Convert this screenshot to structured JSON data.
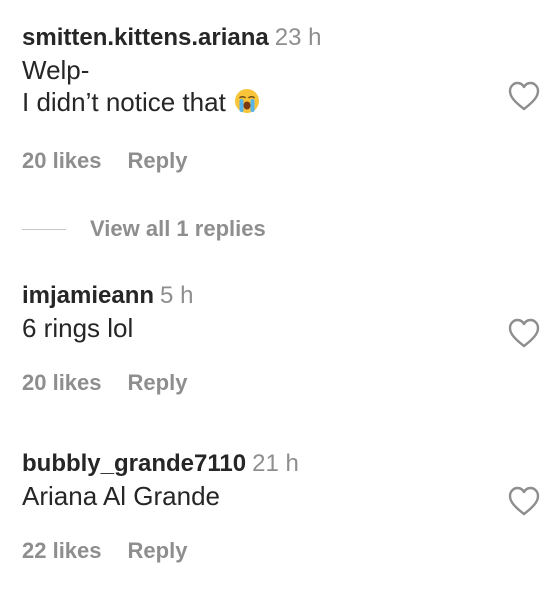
{
  "comments": [
    {
      "username": "smitten.kittens.ariana",
      "time": "23 h",
      "lines": [
        "Welp-",
        "I didn’t notice that"
      ],
      "emoji": "loudly-crying-face",
      "likes": "20 likes",
      "reply": "Reply"
    },
    {
      "username": "imjamieann",
      "time": "5 h",
      "lines": [
        "6 rings lol"
      ],
      "likes": "20 likes",
      "reply": "Reply"
    },
    {
      "username": "bubbly_grande7110",
      "time": "21 h",
      "lines": [
        "Ariana Al Grande"
      ],
      "likes": "22 likes",
      "reply": "Reply"
    }
  ],
  "view_replies": "View all 1 replies",
  "colors": {
    "text": "#262626",
    "muted": "#8e8e8e",
    "divider": "#c7c7c7"
  },
  "icons": {
    "like": "heart-outline-icon",
    "emoji": "loudly-crying-face-icon"
  }
}
